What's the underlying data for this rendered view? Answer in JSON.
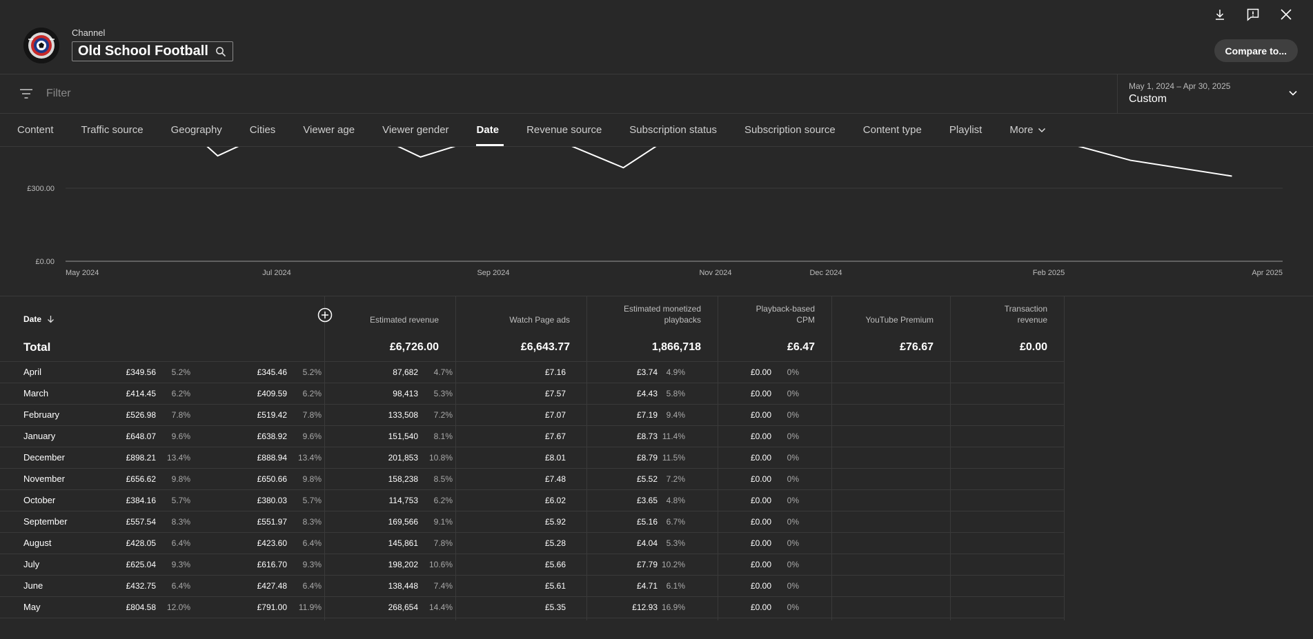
{
  "header": {
    "channel_label": "Channel",
    "channel_name": "Old School Football",
    "compare_label": "Compare to...",
    "icons": [
      "download-icon",
      "feedback-icon",
      "close-icon"
    ]
  },
  "filter": {
    "placeholder": "Filter"
  },
  "date_range": {
    "range": "May 1, 2024 – Apr 30, 2025",
    "preset": "Custom"
  },
  "tabs": [
    "Content",
    "Traffic source",
    "Geography",
    "Cities",
    "Viewer age",
    "Viewer gender",
    "Date",
    "Revenue source",
    "Subscription status",
    "Subscription source",
    "Content type",
    "Playlist",
    "More"
  ],
  "active_tab": "Date",
  "chart_data": {
    "type": "line",
    "x": [
      "May 2024",
      "Jun 2024",
      "Jul 2024",
      "Aug 2024",
      "Sep 2024",
      "Oct 2024",
      "Nov 2024",
      "Dec 2024",
      "Jan 2025",
      "Feb 2025",
      "Mar 2025",
      "Apr 2025"
    ],
    "xticks": [
      "May 2024",
      "Jul 2024",
      "Sep 2024",
      "Nov 2024",
      "Dec 2024",
      "Feb 2025",
      "Apr 2025"
    ],
    "values": [
      804.58,
      432.75,
      625.04,
      428.05,
      557.54,
      384.16,
      656.62,
      898.21,
      648.07,
      526.98,
      414.45,
      349.56
    ],
    "yticks": [
      "£0.00",
      "£300.00"
    ],
    "ylim": [
      0,
      900
    ],
    "grid": true,
    "line_color": "#ffffff"
  },
  "table": {
    "date_header": "Date",
    "columns": [
      {
        "label_lines": [
          "Estimated revenue"
        ]
      },
      {
        "label_lines": [
          "Watch Page ads"
        ]
      },
      {
        "label_lines": [
          "Estimated monetized",
          "playbacks"
        ]
      },
      {
        "label_lines": [
          "Playback-based",
          "CPM"
        ]
      },
      {
        "label_lines": [
          "YouTube Premium"
        ]
      },
      {
        "label_lines": [
          "Transaction",
          "revenue"
        ]
      }
    ],
    "total": {
      "label": "Total",
      "values": [
        "£6,726.00",
        "£6,643.77",
        "1,866,718",
        "£6.47",
        "£76.67",
        "£0.00"
      ]
    },
    "rows": [
      {
        "date": "April",
        "cells": [
          [
            "£349.56",
            "5.2%"
          ],
          [
            "£345.46",
            "5.2%"
          ],
          [
            "87,682",
            "4.7%"
          ],
          [
            "£7.16",
            ""
          ],
          [
            "£3.74",
            "4.9%"
          ],
          [
            "£0.00",
            "0%"
          ]
        ]
      },
      {
        "date": "March",
        "cells": [
          [
            "£414.45",
            "6.2%"
          ],
          [
            "£409.59",
            "6.2%"
          ],
          [
            "98,413",
            "5.3%"
          ],
          [
            "£7.57",
            ""
          ],
          [
            "£4.43",
            "5.8%"
          ],
          [
            "£0.00",
            "0%"
          ]
        ]
      },
      {
        "date": "February",
        "cells": [
          [
            "£526.98",
            "7.8%"
          ],
          [
            "£519.42",
            "7.8%"
          ],
          [
            "133,508",
            "7.2%"
          ],
          [
            "£7.07",
            ""
          ],
          [
            "£7.19",
            "9.4%"
          ],
          [
            "£0.00",
            "0%"
          ]
        ]
      },
      {
        "date": "January",
        "cells": [
          [
            "£648.07",
            "9.6%"
          ],
          [
            "£638.92",
            "9.6%"
          ],
          [
            "151,540",
            "8.1%"
          ],
          [
            "£7.67",
            ""
          ],
          [
            "£8.73",
            "11.4%"
          ],
          [
            "£0.00",
            "0%"
          ]
        ]
      },
      {
        "date": "December",
        "cells": [
          [
            "£898.21",
            "13.4%"
          ],
          [
            "£888.94",
            "13.4%"
          ],
          [
            "201,853",
            "10.8%"
          ],
          [
            "£8.01",
            ""
          ],
          [
            "£8.79",
            "11.5%"
          ],
          [
            "£0.00",
            "0%"
          ]
        ]
      },
      {
        "date": "November",
        "cells": [
          [
            "£656.62",
            "9.8%"
          ],
          [
            "£650.66",
            "9.8%"
          ],
          [
            "158,238",
            "8.5%"
          ],
          [
            "£7.48",
            ""
          ],
          [
            "£5.52",
            "7.2%"
          ],
          [
            "£0.00",
            "0%"
          ]
        ]
      },
      {
        "date": "October",
        "cells": [
          [
            "£384.16",
            "5.7%"
          ],
          [
            "£380.03",
            "5.7%"
          ],
          [
            "114,753",
            "6.2%"
          ],
          [
            "£6.02",
            ""
          ],
          [
            "£3.65",
            "4.8%"
          ],
          [
            "£0.00",
            "0%"
          ]
        ]
      },
      {
        "date": "September",
        "cells": [
          [
            "£557.54",
            "8.3%"
          ],
          [
            "£551.97",
            "8.3%"
          ],
          [
            "169,566",
            "9.1%"
          ],
          [
            "£5.92",
            ""
          ],
          [
            "£5.16",
            "6.7%"
          ],
          [
            "£0.00",
            "0%"
          ]
        ]
      },
      {
        "date": "August",
        "cells": [
          [
            "£428.05",
            "6.4%"
          ],
          [
            "£423.60",
            "6.4%"
          ],
          [
            "145,861",
            "7.8%"
          ],
          [
            "£5.28",
            ""
          ],
          [
            "£4.04",
            "5.3%"
          ],
          [
            "£0.00",
            "0%"
          ]
        ]
      },
      {
        "date": "July",
        "cells": [
          [
            "£625.04",
            "9.3%"
          ],
          [
            "£616.70",
            "9.3%"
          ],
          [
            "198,202",
            "10.6%"
          ],
          [
            "£5.66",
            ""
          ],
          [
            "£7.79",
            "10.2%"
          ],
          [
            "£0.00",
            "0%"
          ]
        ]
      },
      {
        "date": "June",
        "cells": [
          [
            "£432.75",
            "6.4%"
          ],
          [
            "£427.48",
            "6.4%"
          ],
          [
            "138,448",
            "7.4%"
          ],
          [
            "£5.61",
            ""
          ],
          [
            "£4.71",
            "6.1%"
          ],
          [
            "£0.00",
            "0%"
          ]
        ]
      },
      {
        "date": "May",
        "cells": [
          [
            "£804.58",
            "12.0%"
          ],
          [
            "£791.00",
            "11.9%"
          ],
          [
            "268,654",
            "14.4%"
          ],
          [
            "£5.35",
            ""
          ],
          [
            "£12.93",
            "16.9%"
          ],
          [
            "£0.00",
            "0%"
          ]
        ]
      }
    ]
  }
}
